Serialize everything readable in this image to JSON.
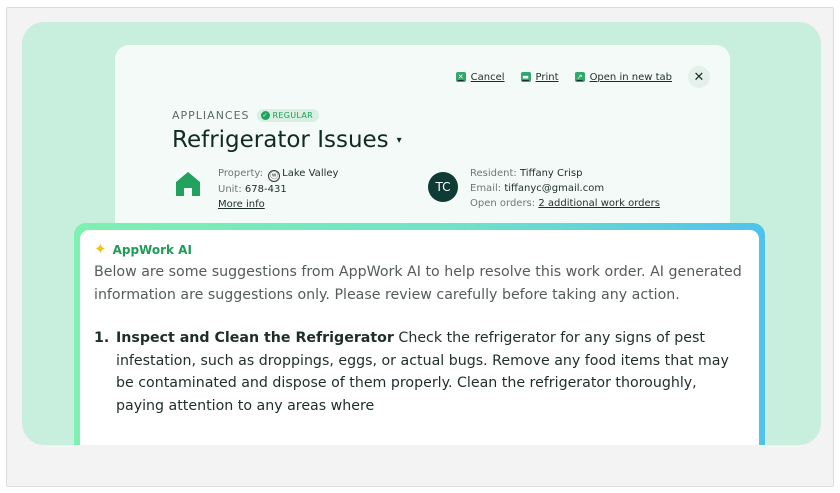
{
  "toolbar": {
    "cancel_label": "Cancel",
    "print_label": "Print",
    "open_label": "Open in new tab",
    "close_glyph": "✕"
  },
  "work_order": {
    "category": "APPLIANCES",
    "badge": "REGULAR",
    "title": "Refrigerator Issues",
    "caret": "▾"
  },
  "property": {
    "property_label": "Property:",
    "property_value": "Lake Valley",
    "unit_label": "Unit:",
    "unit_value": "678-431",
    "more_info": "More info",
    "icon": "house-icon"
  },
  "resident": {
    "initials": "TC",
    "resident_label": "Resident:",
    "resident_value": "Tiffany Crisp",
    "email_label": "Email:",
    "email_value": "tiffanyc@gmail.com",
    "orders_label": "Open orders:",
    "orders_value": "2 additional work orders"
  },
  "ai": {
    "title": "AppWork AI",
    "intro": "Below are some suggestions from AppWork AI to help resolve this work order. AI generated information are suggestions only. Please review carefully before taking any action.",
    "items": [
      {
        "num": "1.",
        "heading": "Inspect and Clean the Refrigerator",
        "body": " Check the refrigerator for any signs of pest infestation, such as droppings, eggs, or actual bugs. Remove any food items that may be contaminated and dispose of them properly. Clean the refrigerator thoroughly, paying attention to any areas where"
      }
    ]
  },
  "colors": {
    "accent": "#2fa86b",
    "mint_bg": "#c8eedd",
    "avatar_bg": "#0f3b35"
  }
}
